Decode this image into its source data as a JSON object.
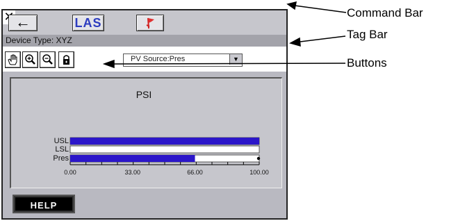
{
  "command_bar": {
    "back_glyph": "←",
    "app_label": "LAS",
    "flag_icon": "flag-icon",
    "close_glyph": "✕"
  },
  "tag_bar": {
    "device_type": "Device Type: XYZ"
  },
  "toolbar": {
    "tools": [
      "hand-icon",
      "zoom-in-icon",
      "zoom-out-icon",
      "lock-icon"
    ],
    "source_value": "PV Source:Pres",
    "source_arrow": "▼"
  },
  "help": {
    "label": "HELP"
  },
  "callouts": {
    "command_bar": "Command Bar",
    "tag_bar": "Tag Bar",
    "buttons": "Buttons"
  },
  "colors": {
    "bar_blue": "#2b16c9",
    "panel_gray": "#c6c6cc"
  },
  "chart_data": {
    "type": "bar",
    "title": "PSI",
    "categories": [
      "USL",
      "LSL",
      "Pres"
    ],
    "values": [
      100,
      0,
      66
    ],
    "xlim": [
      0,
      100
    ],
    "ticks": [
      "0.00",
      "33.00",
      "66.00",
      "100.00"
    ],
    "tick_values": [
      0,
      33,
      66,
      100
    ]
  }
}
